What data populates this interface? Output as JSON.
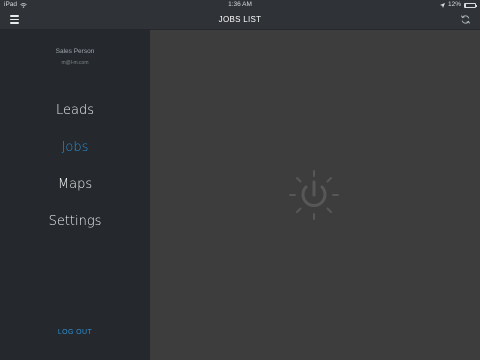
{
  "status": {
    "device": "iPad",
    "time": "1:36 AM",
    "battery": "12%",
    "battery_level": 0.12
  },
  "navbar": {
    "title": "JOBS LIST"
  },
  "sidebar": {
    "user_name": "Sales Person",
    "user_email": "m@l-m.com",
    "items": [
      {
        "label": "Leads"
      },
      {
        "label": "Jobs"
      },
      {
        "label": "Maps"
      },
      {
        "label": "Settings"
      }
    ],
    "active_item": "Jobs",
    "logout_label": "LOG OUT"
  },
  "colors": {
    "accent": "#2b8fd6",
    "sidebar_bg": "#25292d",
    "navbar_bg": "#2f3337",
    "content_bg": "#3d3d3d"
  },
  "icons": {
    "menu": "hamburger-menu-icon",
    "refresh": "refresh-icon",
    "wifi": "wifi-icon",
    "location": "location-arrow-icon",
    "loader": "power-loader-icon"
  }
}
